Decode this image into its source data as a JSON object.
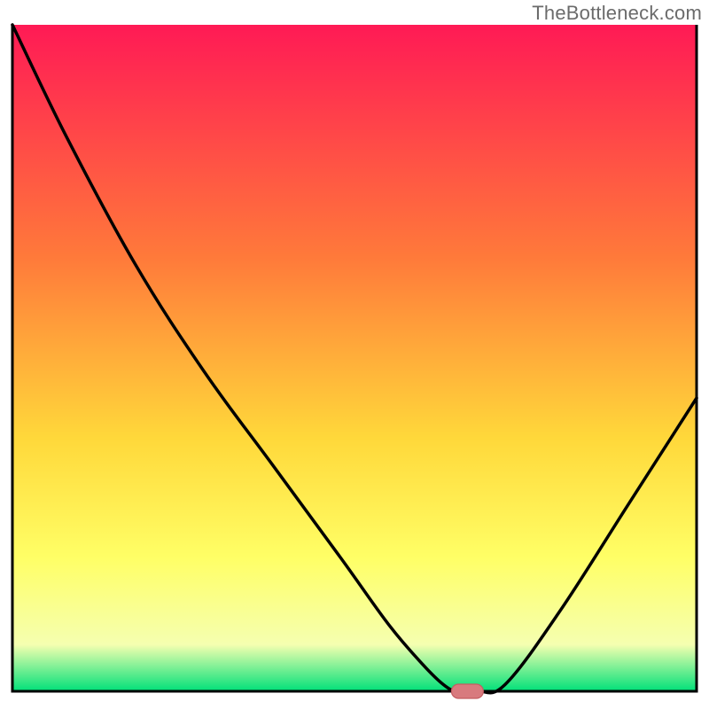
{
  "watermark": "TheBottleneck.com",
  "colors": {
    "frame": "#000000",
    "curve": "#000000",
    "marker_fill": "#d87a7e",
    "marker_stroke": "#c45d62",
    "gradient_top": "#ff1a55",
    "gradient_mid1": "#ff7a3a",
    "gradient_mid2": "#ffd83a",
    "gradient_mid3": "#ffff66",
    "gradient_mid4": "#f5ffb0",
    "gradient_bottom": "#00e079"
  },
  "chart_data": {
    "type": "line",
    "title": "",
    "xlabel": "",
    "ylabel": "",
    "xlim": [
      0,
      100
    ],
    "ylim": [
      0,
      100
    ],
    "grid": false,
    "legend": false,
    "x": [
      0,
      8,
      18,
      28,
      38,
      48,
      55,
      60,
      63,
      65,
      68,
      72,
      80,
      90,
      100
    ],
    "values": [
      100,
      83,
      64,
      48,
      34,
      20,
      10,
      4,
      1,
      0,
      0,
      1,
      12,
      28,
      44
    ],
    "marker": {
      "x": 66.5,
      "y": 0,
      "shape": "capsule"
    },
    "note": "Background is a vertical rainbow gradient from red (top) through orange/yellow to green (bottom). Values represent approximate curve height (0=bottom baseline, 100=top); x is percent across plot width."
  }
}
